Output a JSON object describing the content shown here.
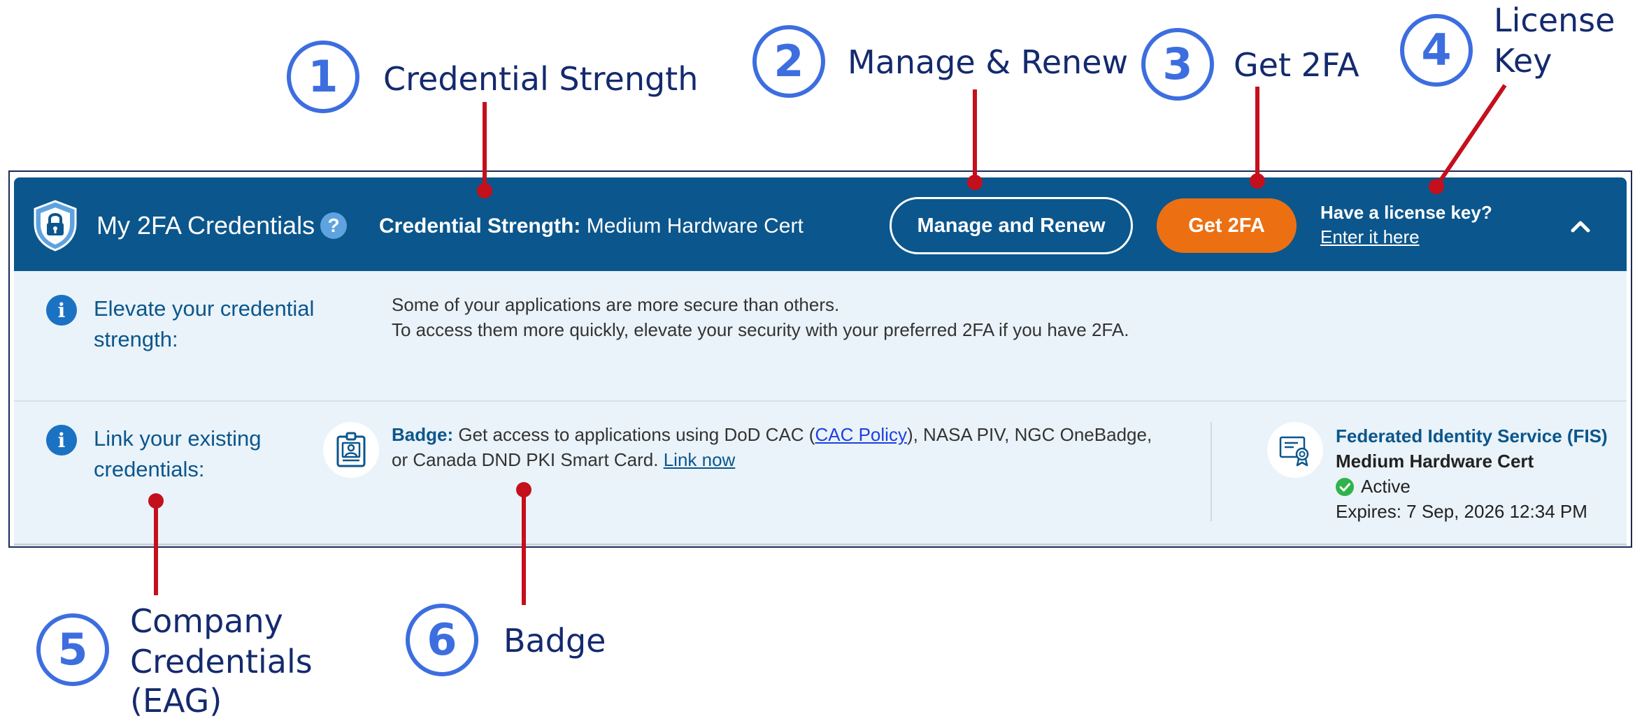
{
  "callouts": [
    {
      "number": "1",
      "label": "Credential Strength"
    },
    {
      "number": "2",
      "label": "Manage & Renew"
    },
    {
      "number": "3",
      "label": "Get 2FA"
    },
    {
      "number": "4",
      "label_lines": [
        "License",
        "Key"
      ]
    },
    {
      "number": "5",
      "label_lines": [
        "Company",
        "Credentials",
        "(EAG)"
      ]
    },
    {
      "number": "6",
      "label": "Badge"
    }
  ],
  "header": {
    "title": "My 2FA Credentials",
    "help_glyph": "?",
    "strength_label": "Credential Strength:",
    "strength_value": "Medium Hardware Cert",
    "manage_button": "Manage and Renew",
    "get_button": "Get 2FA",
    "license_question": "Have a license key?",
    "license_link": "Enter it here",
    "icons": {
      "logo": "shield-lock-icon",
      "collapse": "chevron-up-icon",
      "help": "help-icon"
    }
  },
  "elevate": {
    "title_lines": [
      "Elevate your credential",
      "strength:"
    ],
    "lines": [
      "Some of your applications are more secure than others.",
      "To access them more quickly, elevate your security with your preferred 2FA if you have 2FA."
    ]
  },
  "link_section": {
    "title_lines": [
      "Link your existing",
      "credentials:"
    ],
    "badge": {
      "label": "Badge:",
      "text_a": " Get access to applications using DoD CAC (",
      "policy_link": "CAC Policy",
      "text_b": "), NASA PIV, NGC OneBadge,",
      "text_c": "or Canada DND PKI Smart Card. ",
      "link_now": "Link now",
      "icon": "id-badge-icon"
    },
    "fis": {
      "title": "Federated Identity Service (FIS)",
      "strength": "Medium Hardware Cert",
      "status": "Active",
      "expires": "Expires: 7 Sep, 2026 12:34 PM",
      "icon": "certificate-icon",
      "status_icon": "check-circle-icon"
    }
  },
  "colors": {
    "header_bg": "#0b568c",
    "panel_bg": "#eaf3f9",
    "accent_orange": "#ec7012",
    "callout_blue": "#3d6ee0",
    "pin_red": "#c4101c",
    "success_green": "#2fb34a"
  }
}
